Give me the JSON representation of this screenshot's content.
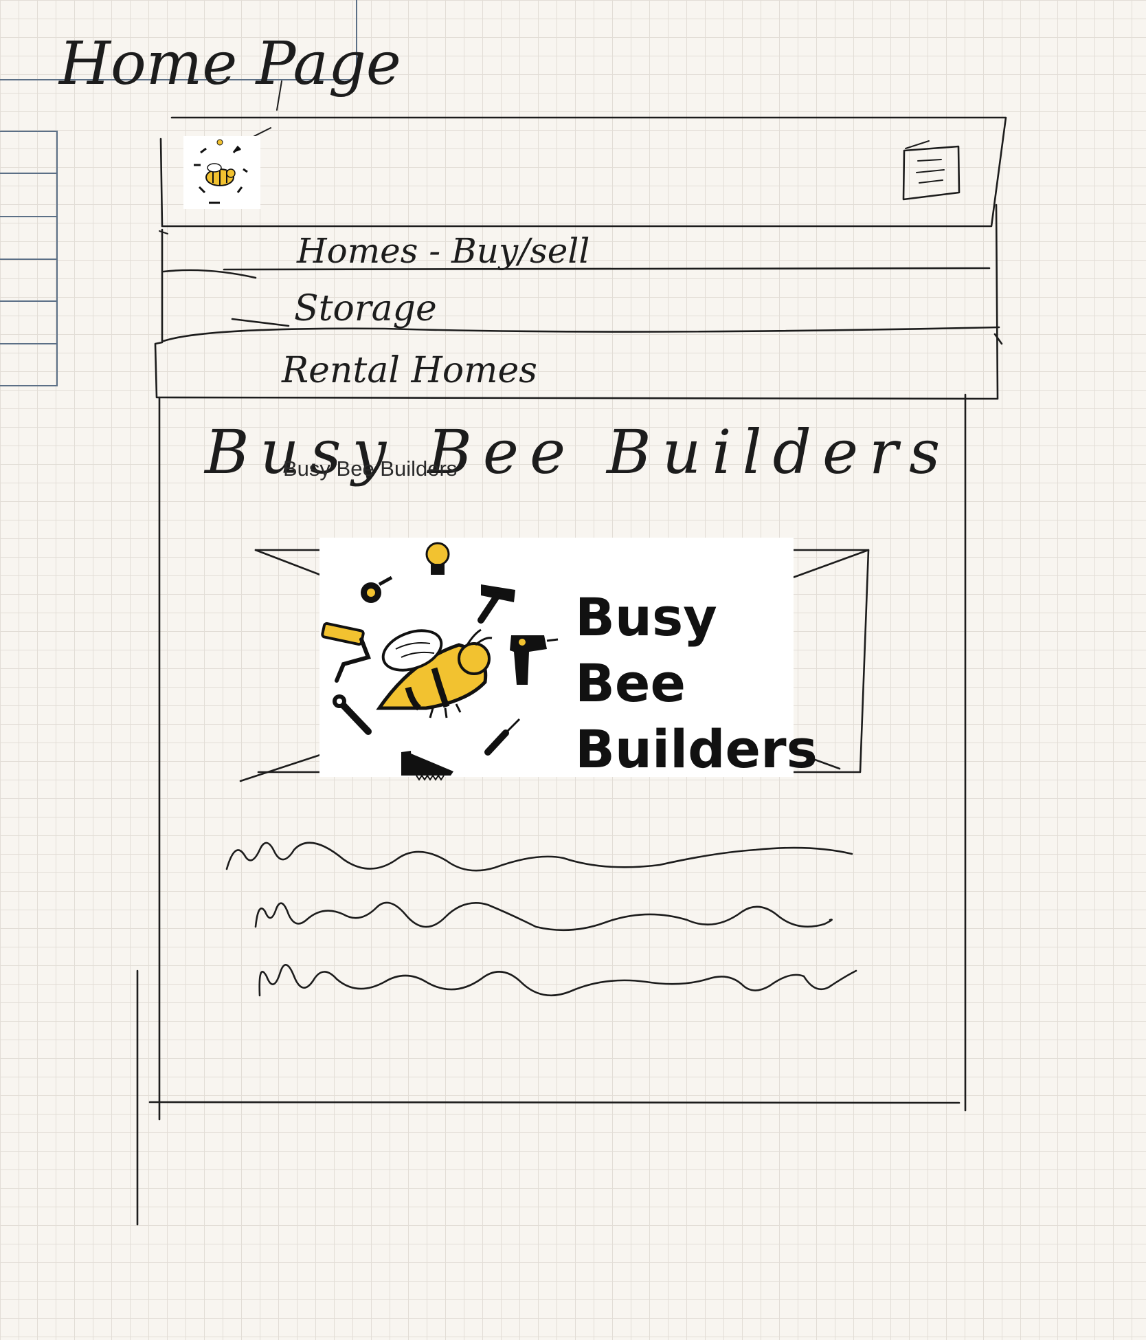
{
  "sketch": {
    "page_title": "Home Page",
    "header": {
      "menu_icon": "hamburger-menu-icon",
      "logo_icon": "bee-logo-icon"
    },
    "nav": {
      "items": [
        {
          "label": "Homes - Buy/sell"
        },
        {
          "label": "Storage"
        },
        {
          "label": "Rental Homes"
        }
      ]
    },
    "main": {
      "handwritten_heading": "Busy Bee Builders",
      "typed_heading": "Busy Bee Builders",
      "hero_logo": {
        "words": [
          "Busy",
          "Bee",
          "Builders"
        ]
      }
    },
    "colors": {
      "ink": "#1c1c1c",
      "paper": "#f8f5f0",
      "grid": "#e2ddd6",
      "bee_yellow": "#f2c230",
      "frame_blue": "#5b6f86"
    }
  }
}
